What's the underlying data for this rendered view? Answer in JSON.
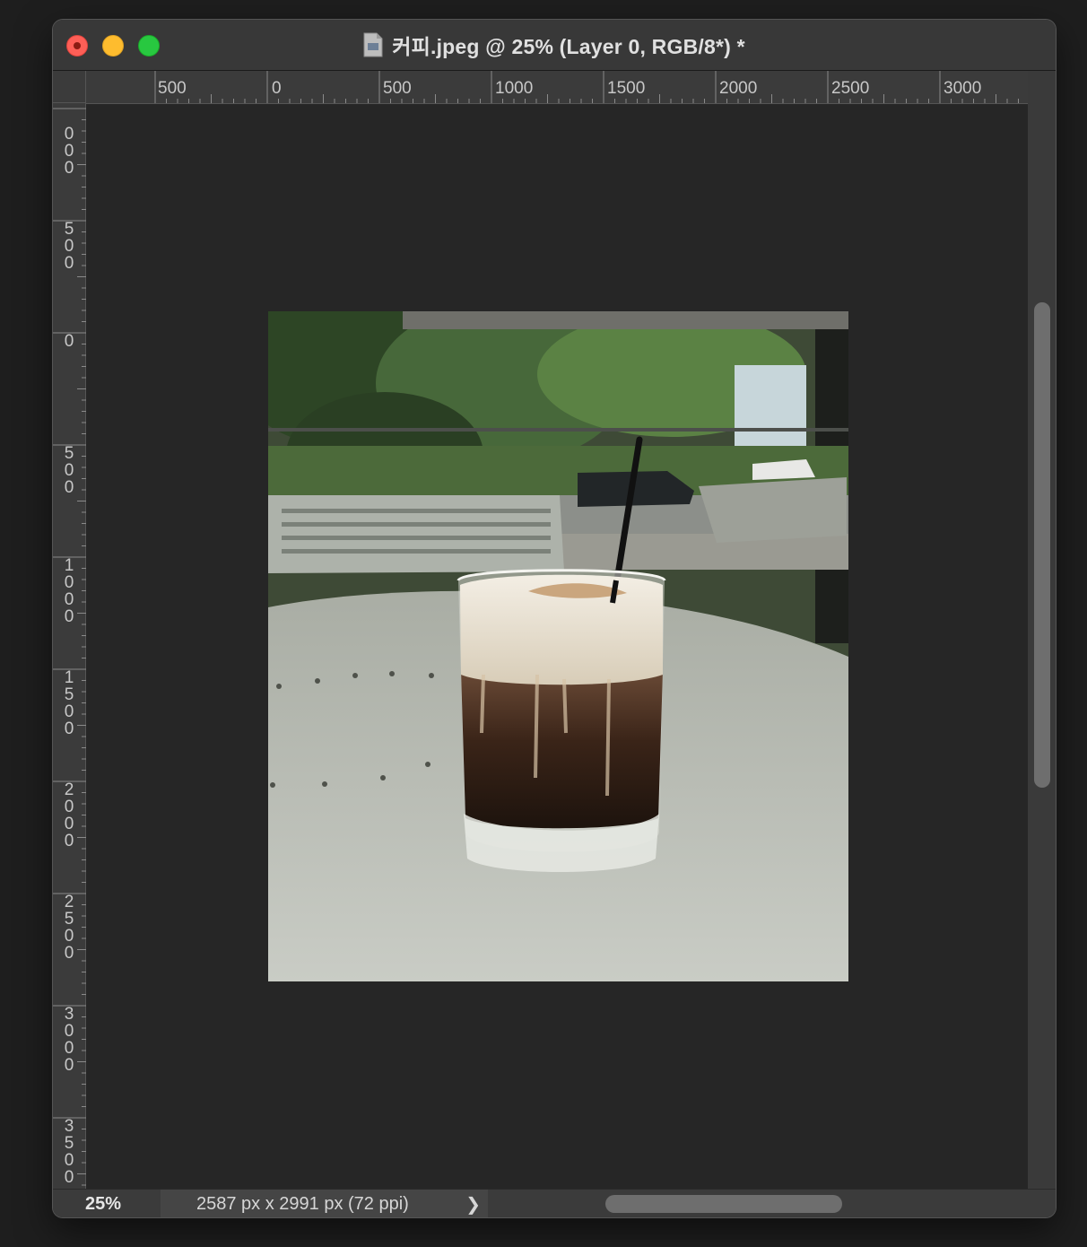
{
  "window": {
    "title": "커피.jpeg @ 25% (Layer 0, RGB/8*) *",
    "file_icon": "document-icon"
  },
  "traffic_lights": [
    "close",
    "minimize",
    "maximize"
  ],
  "ruler_horizontal": {
    "labels": [
      "500",
      "0",
      "500",
      "1000",
      "1500",
      "2000",
      "2500",
      "3000"
    ]
  },
  "ruler_vertical": {
    "labels": [
      "000",
      "500",
      "0",
      "500",
      "1000",
      "1500",
      "2000",
      "2500",
      "3000",
      "3500"
    ]
  },
  "status": {
    "zoom": "25%",
    "doc_info": "2587 px x 2991 px (72 ppi)",
    "arrow": "❯"
  },
  "image": {
    "subject": "iced coffee with cream in a glass on a patio table",
    "name": "커피.jpeg"
  }
}
